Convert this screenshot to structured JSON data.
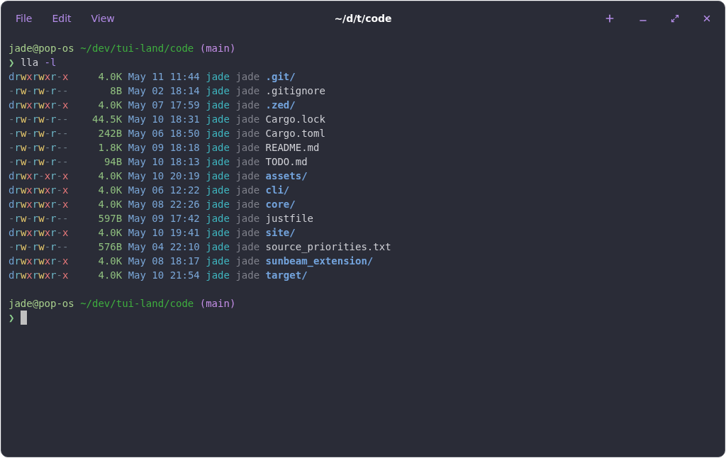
{
  "window": {
    "title": "~/d/t/code",
    "menu": [
      "File",
      "Edit",
      "View"
    ]
  },
  "prompt_1": {
    "user_host": "jade@pop-os",
    "path": "~/dev/tui-land/code",
    "branch": "(main)"
  },
  "command": {
    "symbol": "❯",
    "program": "lla",
    "argument": "-l"
  },
  "listing": [
    {
      "perms": "drwxrwxr-x",
      "size": "4.0K",
      "date": "May 11 11:44",
      "user": "jade",
      "group": "jade",
      "name": ".git/",
      "kind": "dir"
    },
    {
      "perms": "-rw-rw-r--",
      "size": "8B",
      "date": "May 02 18:14",
      "user": "jade",
      "group": "jade",
      "name": ".gitignore",
      "kind": "file"
    },
    {
      "perms": "drwxrwxr-x",
      "size": "4.0K",
      "date": "May 07 17:59",
      "user": "jade",
      "group": "jade",
      "name": ".zed/",
      "kind": "dir"
    },
    {
      "perms": "-rw-rw-r--",
      "size": "44.5K",
      "date": "May 10 18:31",
      "user": "jade",
      "group": "jade",
      "name": "Cargo.lock",
      "kind": "file"
    },
    {
      "perms": "-rw-rw-r--",
      "size": "242B",
      "date": "May 06 18:50",
      "user": "jade",
      "group": "jade",
      "name": "Cargo.toml",
      "kind": "file"
    },
    {
      "perms": "-rw-rw-r--",
      "size": "1.8K",
      "date": "May 09 18:18",
      "user": "jade",
      "group": "jade",
      "name": "README.md",
      "kind": "file"
    },
    {
      "perms": "-rw-rw-r--",
      "size": "94B",
      "date": "May 10 18:13",
      "user": "jade",
      "group": "jade",
      "name": "TODO.md",
      "kind": "file"
    },
    {
      "perms": "drwxr-xr-x",
      "size": "4.0K",
      "date": "May 10 20:19",
      "user": "jade",
      "group": "jade",
      "name": "assets/",
      "kind": "dir"
    },
    {
      "perms": "drwxrwxr-x",
      "size": "4.0K",
      "date": "May 06 12:22",
      "user": "jade",
      "group": "jade",
      "name": "cli/",
      "kind": "dir"
    },
    {
      "perms": "drwxrwxr-x",
      "size": "4.0K",
      "date": "May 08 22:26",
      "user": "jade",
      "group": "jade",
      "name": "core/",
      "kind": "dir"
    },
    {
      "perms": "-rw-rw-r--",
      "size": "597B",
      "date": "May 09 17:42",
      "user": "jade",
      "group": "jade",
      "name": "justfile",
      "kind": "file"
    },
    {
      "perms": "drwxrwxr-x",
      "size": "4.0K",
      "date": "May 10 19:41",
      "user": "jade",
      "group": "jade",
      "name": "site/",
      "kind": "dir"
    },
    {
      "perms": "-rw-rw-r--",
      "size": "576B",
      "date": "May 04 22:10",
      "user": "jade",
      "group": "jade",
      "name": "source_priorities.txt",
      "kind": "file"
    },
    {
      "perms": "drwxrwxr-x",
      "size": "4.0K",
      "date": "May 08 18:17",
      "user": "jade",
      "group": "jade",
      "name": "sunbeam_extension/",
      "kind": "dir"
    },
    {
      "perms": "drwxrwxr-x",
      "size": "4.0K",
      "date": "May 10 21:54",
      "user": "jade",
      "group": "jade",
      "name": "target/",
      "kind": "dir"
    }
  ],
  "prompt_2": {
    "user_host": "jade@pop-os",
    "path": "~/dev/tui-land/code",
    "branch": "(main)",
    "symbol": "❯"
  }
}
